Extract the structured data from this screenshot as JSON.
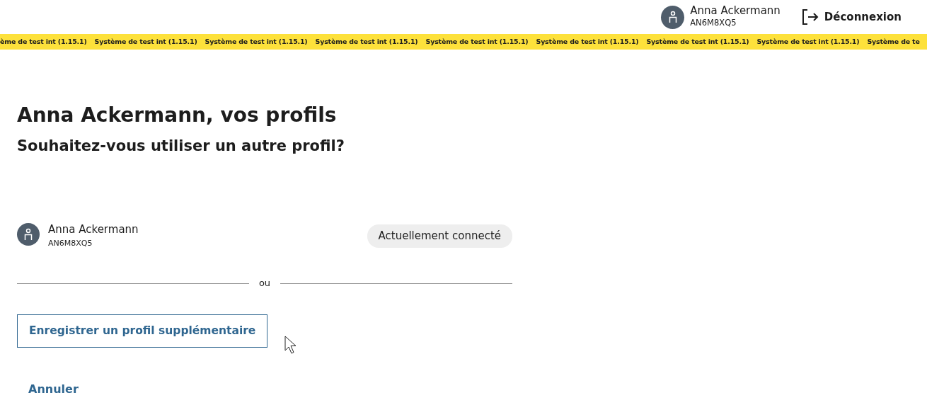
{
  "header": {
    "user": {
      "name": "Anna Ackermann",
      "id": "AN6M8XQ5"
    },
    "logout": "Déconnexion"
  },
  "banner": [
    "ème de test int (1.15.1)",
    "Système de test int (1.15.1)",
    "Système de test int (1.15.1)",
    "Système de test int (1.15.1)",
    "Système de test int (1.15.1)",
    "Système de test int (1.15.1)",
    "Système de test int (1.15.1)",
    "Système de test int (1.15.1)",
    "Système de te"
  ],
  "title": "Anna Ackermann, vos profils",
  "subtitle": "Souhaitez-vous utiliser un autre profil?",
  "profiles": [
    {
      "name": "Anna Ackermann",
      "id": "AN6M8XQ5",
      "status": "Actuellement connecté"
    }
  ],
  "divider": "ou",
  "register_button": "Enregistrer un profil supplémentaire",
  "cancel_link": "Annuler"
}
